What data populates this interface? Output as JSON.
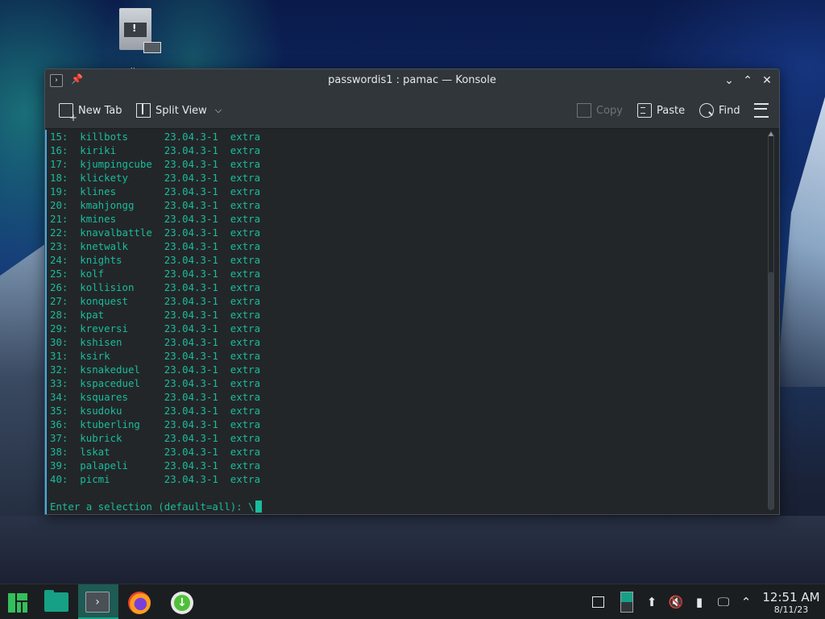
{
  "desktop": {
    "icon_label": "pollyma"
  },
  "window": {
    "title": "passwordis1 : pamac — Konsole",
    "app_icon": "terminal-icon",
    "controls": [
      "minimize",
      "maximize",
      "close"
    ]
  },
  "toolbar": {
    "new_tab_label": "New Tab",
    "split_view_label": "Split View",
    "copy_label": "Copy",
    "paste_label": "Paste",
    "find_label": "Find"
  },
  "terminal": {
    "text_color": "#1abc9c",
    "lines": [
      "15:  killbots      23.04.3-1  extra",
      "16:  kiriki        23.04.3-1  extra",
      "17:  kjumpingcube  23.04.3-1  extra",
      "18:  klickety      23.04.3-1  extra",
      "19:  klines        23.04.3-1  extra",
      "20:  kmahjongg     23.04.3-1  extra",
      "21:  kmines        23.04.3-1  extra",
      "22:  knavalbattle  23.04.3-1  extra",
      "23:  knetwalk      23.04.3-1  extra",
      "24:  knights       23.04.3-1  extra",
      "25:  kolf          23.04.3-1  extra",
      "26:  kollision     23.04.3-1  extra",
      "27:  konquest      23.04.3-1  extra",
      "28:  kpat          23.04.3-1  extra",
      "29:  kreversi      23.04.3-1  extra",
      "30:  kshisen       23.04.3-1  extra",
      "31:  ksirk         23.04.3-1  extra",
      "32:  ksnakeduel    23.04.3-1  extra",
      "33:  kspaceduel    23.04.3-1  extra",
      "34:  ksquares      23.04.3-1  extra",
      "35:  ksudoku       23.04.3-1  extra",
      "36:  ktuberling    23.04.3-1  extra",
      "37:  kubrick       23.04.3-1  extra",
      "38:  lskat         23.04.3-1  extra",
      "39:  palapeli      23.04.3-1  extra",
      "40:  picmi         23.04.3-1  extra"
    ],
    "prompt": "Enter a selection (default=all): \\"
  },
  "taskbar": {
    "apps": [
      "manjaro-menu-icon",
      "files-icon",
      "konsole-icon",
      "firefox-icon",
      "pamac-icon"
    ],
    "clock_time": "12:51 AM",
    "clock_date": "8/11/23"
  }
}
